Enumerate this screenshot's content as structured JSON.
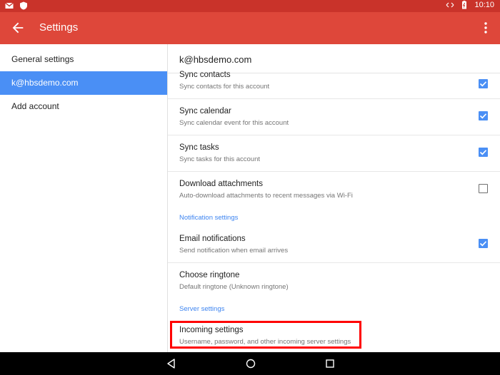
{
  "status_bar": {
    "time": "10:10",
    "icons": [
      "gmail-icon",
      "shield-icon",
      "data-transfer-icon",
      "battery-icon"
    ]
  },
  "app_bar": {
    "title": "Settings",
    "back_icon": "arrow-back-icon",
    "overflow_icon": "more-vert-icon"
  },
  "sidebar": {
    "items": [
      {
        "label": "General settings",
        "selected": false
      },
      {
        "label": "k@hbsdemo.com",
        "selected": true
      },
      {
        "label": "Add account",
        "selected": false
      }
    ]
  },
  "main": {
    "account_title": "k@hbsdemo.com",
    "sync_contacts": {
      "title": "Sync contacts",
      "subtitle": "Sync contacts for this account",
      "checked": true
    },
    "sync_calendar": {
      "title": "Sync calendar",
      "subtitle": "Sync calendar event for this account",
      "checked": true
    },
    "sync_tasks": {
      "title": "Sync tasks",
      "subtitle": "Sync tasks for this account",
      "checked": true
    },
    "download_attachments": {
      "title": "Download attachments",
      "subtitle": "Auto-download attachments to recent messages via Wi-Fi",
      "checked": false
    },
    "notification_section": "Notification settings",
    "email_notifications": {
      "title": "Email notifications",
      "subtitle": "Send notification when email arrives",
      "checked": true
    },
    "choose_ringtone": {
      "title": "Choose ringtone",
      "subtitle": "Default ringtone (Unknown ringtone)"
    },
    "server_section": "Server settings",
    "incoming_settings": {
      "title": "Incoming settings",
      "subtitle": "Username, password, and other incoming server settings"
    }
  },
  "colors": {
    "status_bar": "#c9332a",
    "app_bar": "#de473a",
    "accent": "#4a8ff5",
    "highlight": "#ff0000"
  },
  "nav_bar": {
    "icons": [
      "back-triangle-icon",
      "home-circle-icon",
      "recents-square-icon"
    ]
  }
}
